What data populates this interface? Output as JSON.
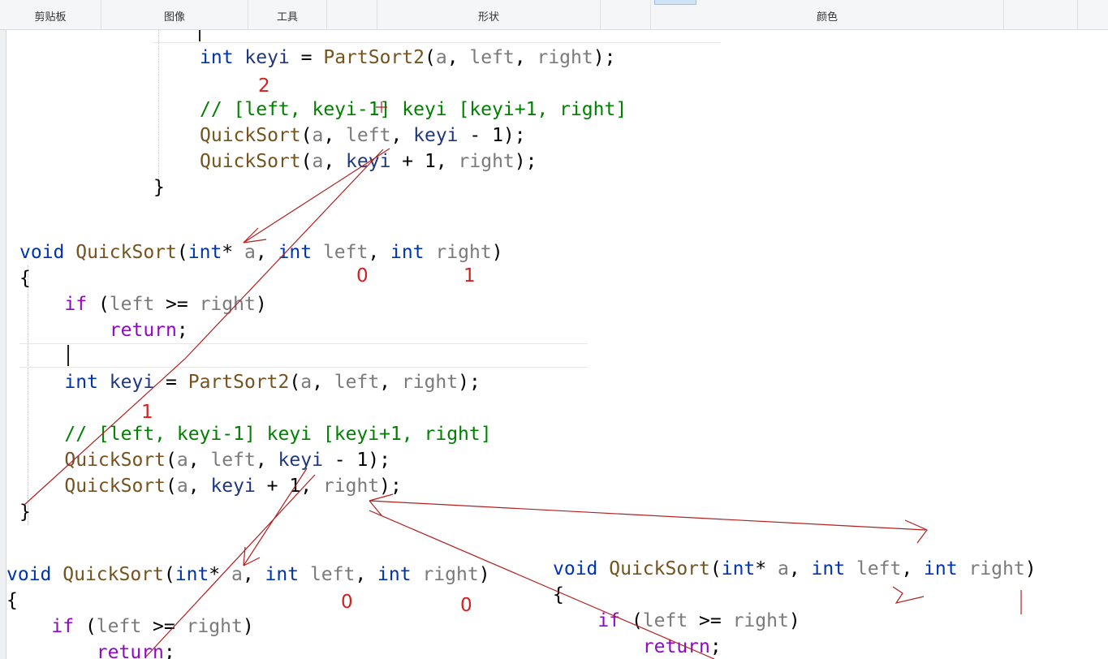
{
  "ribbon": {
    "groups": [
      "剪贴板",
      "图像",
      "工具",
      "形状",
      "颜色"
    ]
  },
  "code_top": {
    "lines": [
      [
        {
          "t": "int",
          "c": "kw"
        },
        {
          "t": " ",
          "c": "pl"
        },
        {
          "t": "keyi",
          "c": "var"
        },
        {
          "t": " = ",
          "c": "pl"
        },
        {
          "t": "PartSort2",
          "c": "fn"
        },
        {
          "t": "(",
          "c": "pl"
        },
        {
          "t": "a",
          "c": "prm"
        },
        {
          "t": ", ",
          "c": "pl"
        },
        {
          "t": "left",
          "c": "prm"
        },
        {
          "t": ", ",
          "c": "pl"
        },
        {
          "t": "right",
          "c": "prm"
        },
        {
          "t": ");",
          "c": "pl"
        }
      ],
      [],
      [
        {
          "t": "// [left, keyi-1] keyi [keyi+1, right]",
          "c": "cmt"
        }
      ],
      [
        {
          "t": "QuickSort",
          "c": "fn"
        },
        {
          "t": "(",
          "c": "pl"
        },
        {
          "t": "a",
          "c": "prm"
        },
        {
          "t": ", ",
          "c": "pl"
        },
        {
          "t": "left",
          "c": "prm"
        },
        {
          "t": ", ",
          "c": "pl"
        },
        {
          "t": "keyi",
          "c": "var"
        },
        {
          "t": " - 1);",
          "c": "pl"
        }
      ],
      [
        {
          "t": "QuickSort",
          "c": "fn"
        },
        {
          "t": "(",
          "c": "pl"
        },
        {
          "t": "a",
          "c": "prm"
        },
        {
          "t": ", ",
          "c": "pl"
        },
        {
          "t": "keyi",
          "c": "var"
        },
        {
          "t": " + 1, ",
          "c": "pl"
        },
        {
          "t": "right",
          "c": "prm"
        },
        {
          "t": ");",
          "c": "pl"
        }
      ]
    ],
    "closing_brace": "}"
  },
  "code_mid": {
    "lines": [
      [
        {
          "t": "void",
          "c": "kw"
        },
        {
          "t": " ",
          "c": "pl"
        },
        {
          "t": "QuickSort",
          "c": "fn"
        },
        {
          "t": "(",
          "c": "pl"
        },
        {
          "t": "int",
          "c": "kw"
        },
        {
          "t": "* ",
          "c": "pl"
        },
        {
          "t": "a",
          "c": "prm"
        },
        {
          "t": ", ",
          "c": "pl"
        },
        {
          "t": "int",
          "c": "kw"
        },
        {
          "t": " ",
          "c": "pl"
        },
        {
          "t": "left",
          "c": "prm"
        },
        {
          "t": ", ",
          "c": "pl"
        },
        {
          "t": "int",
          "c": "kw"
        },
        {
          "t": " ",
          "c": "pl"
        },
        {
          "t": "right",
          "c": "prm"
        },
        {
          "t": ")",
          "c": "pl"
        }
      ],
      [
        {
          "t": "{",
          "c": "pl"
        }
      ],
      [
        {
          "t": "    ",
          "c": "pl"
        },
        {
          "t": "if",
          "c": "ctl"
        },
        {
          "t": " (",
          "c": "pl"
        },
        {
          "t": "left",
          "c": "prm"
        },
        {
          "t": " >= ",
          "c": "pl"
        },
        {
          "t": "right",
          "c": "prm"
        },
        {
          "t": ")",
          "c": "pl"
        }
      ],
      [
        {
          "t": "        ",
          "c": "pl"
        },
        {
          "t": "return",
          "c": "ctl"
        },
        {
          "t": ";",
          "c": "pl"
        }
      ],
      [],
      [
        {
          "t": "    ",
          "c": "pl"
        },
        {
          "t": "int",
          "c": "kw"
        },
        {
          "t": " ",
          "c": "pl"
        },
        {
          "t": "keyi",
          "c": "var"
        },
        {
          "t": " = ",
          "c": "pl"
        },
        {
          "t": "PartSort2",
          "c": "fn"
        },
        {
          "t": "(",
          "c": "pl"
        },
        {
          "t": "a",
          "c": "prm"
        },
        {
          "t": ", ",
          "c": "pl"
        },
        {
          "t": "left",
          "c": "prm"
        },
        {
          "t": ", ",
          "c": "pl"
        },
        {
          "t": "right",
          "c": "prm"
        },
        {
          "t": ");",
          "c": "pl"
        }
      ],
      [],
      [
        {
          "t": "    // [left, keyi-1] keyi [keyi+1, right]",
          "c": "cmt"
        }
      ],
      [
        {
          "t": "    ",
          "c": "pl"
        },
        {
          "t": "QuickSort",
          "c": "fn"
        },
        {
          "t": "(",
          "c": "pl"
        },
        {
          "t": "a",
          "c": "prm"
        },
        {
          "t": ", ",
          "c": "pl"
        },
        {
          "t": "left",
          "c": "prm"
        },
        {
          "t": ", ",
          "c": "pl"
        },
        {
          "t": "keyi",
          "c": "var"
        },
        {
          "t": " - 1);",
          "c": "pl"
        }
      ],
      [
        {
          "t": "    ",
          "c": "pl"
        },
        {
          "t": "QuickSort",
          "c": "fn"
        },
        {
          "t": "(",
          "c": "pl"
        },
        {
          "t": "a",
          "c": "prm"
        },
        {
          "t": ", ",
          "c": "pl"
        },
        {
          "t": "keyi",
          "c": "var"
        },
        {
          "t": " + 1, ",
          "c": "pl"
        },
        {
          "t": "right",
          "c": "prm"
        },
        {
          "t": ");",
          "c": "pl"
        }
      ],
      [
        {
          "t": "}",
          "c": "pl"
        }
      ]
    ]
  },
  "code_bl": {
    "lines": [
      [
        {
          "t": "void",
          "c": "kw"
        },
        {
          "t": " ",
          "c": "pl"
        },
        {
          "t": "QuickSort",
          "c": "fn"
        },
        {
          "t": "(",
          "c": "pl"
        },
        {
          "t": "int",
          "c": "kw"
        },
        {
          "t": "* ",
          "c": "pl"
        },
        {
          "t": "a",
          "c": "prm"
        },
        {
          "t": ", ",
          "c": "pl"
        },
        {
          "t": "int",
          "c": "kw"
        },
        {
          "t": " ",
          "c": "pl"
        },
        {
          "t": "left",
          "c": "prm"
        },
        {
          "t": ", ",
          "c": "pl"
        },
        {
          "t": "int",
          "c": "kw"
        },
        {
          "t": " ",
          "c": "pl"
        },
        {
          "t": "right",
          "c": "prm"
        },
        {
          "t": ")",
          "c": "pl"
        }
      ],
      [
        {
          "t": "{",
          "c": "pl"
        }
      ],
      [
        {
          "t": "    ",
          "c": "pl"
        },
        {
          "t": "if",
          "c": "ctl"
        },
        {
          "t": " (",
          "c": "pl"
        },
        {
          "t": "left",
          "c": "prm"
        },
        {
          "t": " >= ",
          "c": "pl"
        },
        {
          "t": "right",
          "c": "prm"
        },
        {
          "t": ")",
          "c": "pl"
        }
      ],
      [
        {
          "t": "        ",
          "c": "pl"
        },
        {
          "t": "return",
          "c": "ctl"
        },
        {
          "t": ";",
          "c": "pl"
        }
      ]
    ]
  },
  "code_br": {
    "lines": [
      [
        {
          "t": "void",
          "c": "kw"
        },
        {
          "t": " ",
          "c": "pl"
        },
        {
          "t": "QuickSort",
          "c": "fn"
        },
        {
          "t": "(",
          "c": "pl"
        },
        {
          "t": "int",
          "c": "kw"
        },
        {
          "t": "* ",
          "c": "pl"
        },
        {
          "t": "a",
          "c": "prm"
        },
        {
          "t": ", ",
          "c": "pl"
        },
        {
          "t": "int",
          "c": "kw"
        },
        {
          "t": " ",
          "c": "pl"
        },
        {
          "t": "left",
          "c": "prm"
        },
        {
          "t": ", ",
          "c": "pl"
        },
        {
          "t": "int",
          "c": "kw"
        },
        {
          "t": " ",
          "c": "pl"
        },
        {
          "t": "right",
          "c": "prm"
        },
        {
          "t": ")",
          "c": "pl"
        }
      ],
      [
        {
          "t": "{",
          "c": "pl"
        }
      ],
      [
        {
          "t": "    ",
          "c": "pl"
        },
        {
          "t": "if",
          "c": "ctl"
        },
        {
          "t": " (",
          "c": "pl"
        },
        {
          "t": "left",
          "c": "prm"
        },
        {
          "t": " >= ",
          "c": "pl"
        },
        {
          "t": "right",
          "c": "prm"
        },
        {
          "t": ")",
          "c": "pl"
        }
      ],
      [
        {
          "t": "        ",
          "c": "pl"
        },
        {
          "t": "return",
          "c": "ctl"
        },
        {
          "t": ";",
          "c": "pl"
        }
      ]
    ]
  },
  "annotations": {
    "top_keyi": "2",
    "mid_left": "0",
    "mid_right": "1",
    "mid_keyi": "1",
    "bl_left": "0",
    "bl_right": "0"
  },
  "ink_color": "#b02020"
}
